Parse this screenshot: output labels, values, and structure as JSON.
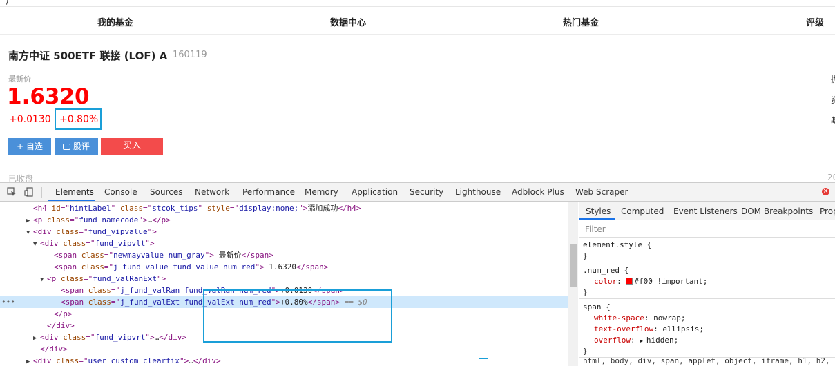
{
  "page": {
    "nav": [
      "我的基金",
      "数据中心",
      "热门基金",
      "评级"
    ],
    "fund_name": "南方中证 500ETF 联接 (LOF) A",
    "fund_code": "160119",
    "latest_label": "最新价",
    "price": "1.6320",
    "change_abs": "+0.0130",
    "change_pct": "+0.80%",
    "btn_watch": "+ 自选",
    "btn_comment": "股评",
    "btn_buy": "买入",
    "closed_label": "已收盘",
    "closed_right": "20",
    "edge_chars": [
      "抛",
      "资",
      "基"
    ]
  },
  "devtools": {
    "tabs": [
      "Elements",
      "Console",
      "Sources",
      "Network",
      "Performance",
      "Memory",
      "Application",
      "Security",
      "Lighthouse",
      "Adblock Plus",
      "Web Scraper"
    ],
    "error_badge": "×",
    "dom_lines": [
      {
        "indent": 4,
        "tri": "",
        "parts": [
          [
            "tag",
            "<h4 "
          ],
          [
            "attr",
            "id"
          ],
          [
            "tag",
            "=\""
          ],
          [
            "val",
            "hintLabel"
          ],
          [
            "tag",
            "\" "
          ],
          [
            "attr",
            "class"
          ],
          [
            "tag",
            "=\""
          ],
          [
            "val",
            "stcok_tips"
          ],
          [
            "tag",
            "\" "
          ],
          [
            "attr",
            "style"
          ],
          [
            "tag",
            "=\""
          ],
          [
            "val",
            "display:none;"
          ],
          [
            "tag",
            "\">"
          ],
          [
            "txt",
            "添加成功"
          ],
          [
            "tag",
            "</h4>"
          ]
        ]
      },
      {
        "indent": 4,
        "tri": "▶",
        "parts": [
          [
            "tag",
            "<p "
          ],
          [
            "attr",
            "class"
          ],
          [
            "tag",
            "=\""
          ],
          [
            "val",
            "fund_namecode"
          ],
          [
            "tag",
            "\">"
          ],
          [
            "txt",
            "…"
          ],
          [
            "tag",
            "</p>"
          ]
        ]
      },
      {
        "indent": 4,
        "tri": "▼",
        "parts": [
          [
            "tag",
            "<div "
          ],
          [
            "attr",
            "class"
          ],
          [
            "tag",
            "=\""
          ],
          [
            "val",
            "fund_vipvalue"
          ],
          [
            "tag",
            "\">"
          ]
        ]
      },
      {
        "indent": 5,
        "tri": "▼",
        "parts": [
          [
            "tag",
            "<div "
          ],
          [
            "attr",
            "class"
          ],
          [
            "tag",
            "=\""
          ],
          [
            "val",
            "fund_vipvlt"
          ],
          [
            "tag",
            "\">"
          ]
        ]
      },
      {
        "indent": 7,
        "tri": "",
        "parts": [
          [
            "tag",
            "<span "
          ],
          [
            "attr",
            "class"
          ],
          [
            "tag",
            "=\""
          ],
          [
            "val",
            "newmayvalue num_gray"
          ],
          [
            "tag",
            "\">"
          ],
          [
            "txt",
            " 最新价"
          ],
          [
            "tag",
            "</span>"
          ]
        ]
      },
      {
        "indent": 7,
        "tri": "",
        "parts": [
          [
            "tag",
            "<span "
          ],
          [
            "attr",
            "class"
          ],
          [
            "tag",
            "=\""
          ],
          [
            "val",
            "j_fund_value fund_value num_red"
          ],
          [
            "tag",
            "\">"
          ],
          [
            "txt",
            " 1.6320"
          ],
          [
            "tag",
            "</span>"
          ]
        ]
      },
      {
        "indent": 6,
        "tri": "▼",
        "parts": [
          [
            "tag",
            "<p "
          ],
          [
            "attr",
            "class"
          ],
          [
            "tag",
            "=\""
          ],
          [
            "val",
            "fund_valRanExt"
          ],
          [
            "tag",
            "\">"
          ]
        ]
      },
      {
        "indent": 8,
        "tri": "",
        "parts": [
          [
            "tag",
            "<span "
          ],
          [
            "attr",
            "class"
          ],
          [
            "tag",
            "=\""
          ],
          [
            "val",
            "j_fund_valRan fund_valRan num_red"
          ],
          [
            "tag",
            "\">"
          ],
          [
            "txt",
            "+0.0130"
          ],
          [
            "tag",
            "</span>"
          ]
        ]
      },
      {
        "indent": 8,
        "tri": "",
        "selected": true,
        "parts": [
          [
            "tag",
            "<span "
          ],
          [
            "attr",
            "class"
          ],
          [
            "tag",
            "=\""
          ],
          [
            "val",
            "j_fund_valExt fund_valExt num_red"
          ],
          [
            "tag",
            "\">"
          ],
          [
            "txt",
            "+0.80%"
          ],
          [
            "tag",
            "</span>"
          ],
          [
            "hint",
            " == $0"
          ]
        ]
      },
      {
        "indent": 7,
        "tri": "",
        "parts": [
          [
            "tag",
            "</p>"
          ]
        ]
      },
      {
        "indent": 6,
        "tri": "",
        "parts": [
          [
            "tag",
            "</div>"
          ]
        ]
      },
      {
        "indent": 5,
        "tri": "▶",
        "parts": [
          [
            "tag",
            "<div "
          ],
          [
            "attr",
            "class"
          ],
          [
            "tag",
            "=\""
          ],
          [
            "val",
            "fund_vipvrt"
          ],
          [
            "tag",
            "\">"
          ],
          [
            "txt",
            "…"
          ],
          [
            "tag",
            "</div>"
          ]
        ]
      },
      {
        "indent": 5,
        "tri": "",
        "parts": [
          [
            "tag",
            "</div>"
          ]
        ]
      },
      {
        "indent": 4,
        "tri": "▶",
        "parts": [
          [
            "tag",
            "<div "
          ],
          [
            "attr",
            "class"
          ],
          [
            "tag",
            "=\""
          ],
          [
            "val",
            "user_custom clearfix"
          ],
          [
            "tag",
            "\">"
          ],
          [
            "txt",
            "…"
          ],
          [
            "tag",
            "</div>"
          ]
        ]
      }
    ],
    "styles_tabs": [
      "Styles",
      "Computed",
      "Event Listeners",
      "DOM Breakpoints",
      "Prop"
    ],
    "filter_placeholder": "Filter",
    "rules": [
      {
        "selector": "element.style {",
        "decls": [],
        "close": "}"
      },
      {
        "selector": ".num_red {",
        "decls": [
          {
            "prop": "color",
            "val": "#f00 !important;",
            "swatch": "#ff0000"
          }
        ],
        "close": "}"
      },
      {
        "selector": "span {",
        "decls": [
          {
            "prop": "white-space",
            "val": "nowrap;"
          },
          {
            "prop": "text-overflow",
            "val": "ellipsis;"
          },
          {
            "prop": "overflow",
            "val": "hidden;",
            "tri": "▶"
          }
        ],
        "close": "}"
      }
    ],
    "inherit_line": "html, body, div, span, applet, object, iframe, h1, h2, h"
  }
}
